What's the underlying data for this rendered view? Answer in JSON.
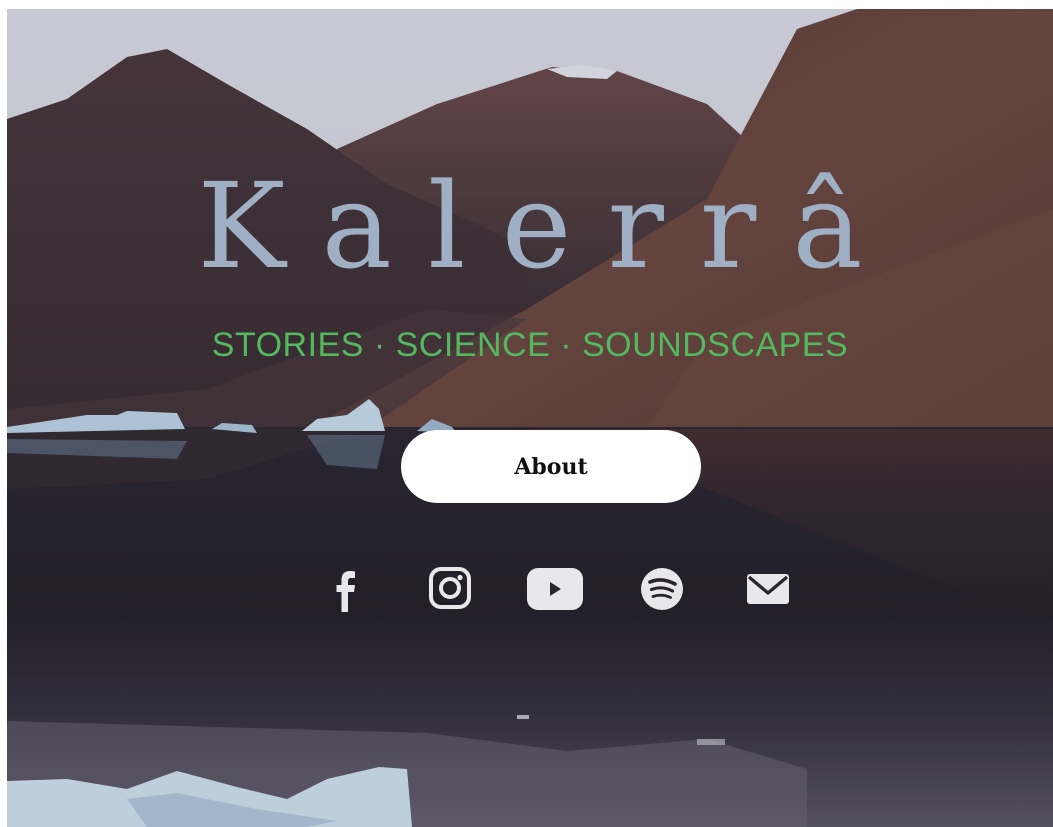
{
  "brand": {
    "name": "Kalerrâ",
    "tagline": "STORIES · SCIENCE · SOUNDSCAPES"
  },
  "nav": {
    "about_label": "About"
  },
  "social_links": [
    {
      "icon": "facebook-icon"
    },
    {
      "icon": "instagram-icon"
    },
    {
      "icon": "youtube-icon"
    },
    {
      "icon": "spotify-icon"
    },
    {
      "icon": "email-icon"
    }
  ],
  "colors": {
    "brand_text": "#9fb0c4",
    "tagline_text": "#53b85e",
    "button_bg": "#ffffff",
    "button_text": "#111111",
    "icon_color": "#e8e8ea"
  }
}
